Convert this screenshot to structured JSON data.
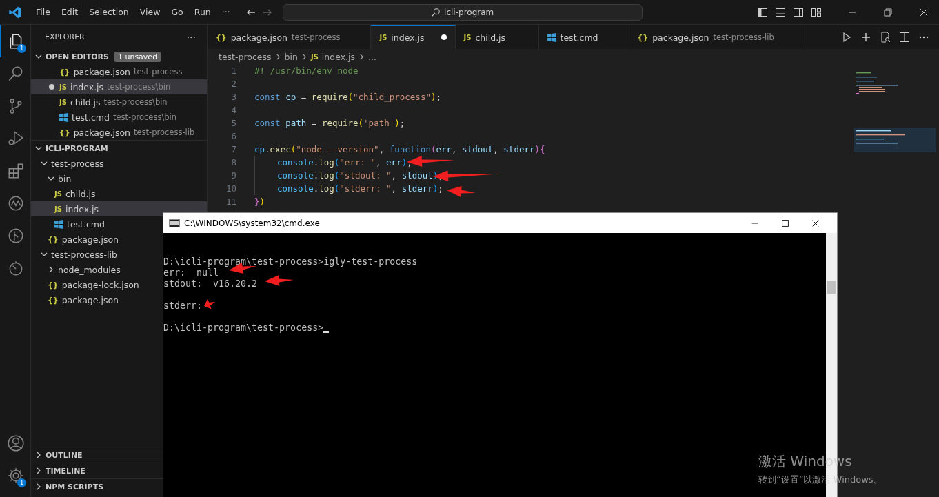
{
  "title_bar": {
    "menus": [
      "File",
      "Edit",
      "Selection",
      "View",
      "Go",
      "Run"
    ],
    "more": "···",
    "search": "icli-program"
  },
  "activity_bar": {
    "top": [
      {
        "kind": "explorer",
        "selected": true,
        "badge": "1"
      },
      {
        "kind": "search",
        "selected": false
      },
      {
        "kind": "source-control",
        "selected": false
      },
      {
        "kind": "run-debug",
        "selected": false
      },
      {
        "kind": "extensions",
        "selected": false
      },
      {
        "kind": "aw",
        "selected": false
      },
      {
        "kind": "git-graph",
        "selected": false
      },
      {
        "kind": "timer",
        "selected": false
      }
    ],
    "bottom": [
      {
        "kind": "account",
        "selected": false
      },
      {
        "kind": "settings",
        "selected": false,
        "badge": "1"
      }
    ]
  },
  "sidebar": {
    "title": "EXPLORER",
    "more": "···",
    "open_editors": {
      "title": "OPEN EDITORS",
      "expanded": true,
      "badge": "1 unsaved",
      "items": [
        {
          "icon": {
            "kind": "json",
            "text": "{}"
          },
          "name": "package.json",
          "path": "test-process",
          "modified": false,
          "selected": false
        },
        {
          "icon": {
            "kind": "js",
            "text": "JS"
          },
          "name": "index.js",
          "path": "test-process\\bin",
          "modified": true,
          "selected": true
        },
        {
          "icon": {
            "kind": "js",
            "text": "JS"
          },
          "name": "child.js",
          "path": "test-process\\bin",
          "modified": false,
          "selected": false
        },
        {
          "icon": {
            "kind": "cmd"
          },
          "name": "test.cmd",
          "path": "test-process\\bin",
          "modified": false,
          "selected": false
        },
        {
          "icon": {
            "kind": "json",
            "text": "{}"
          },
          "name": "package.json",
          "path": "test-process-lib",
          "modified": false,
          "selected": false
        }
      ]
    },
    "folder": {
      "title": "ICLI-PROGRAM",
      "expanded": true,
      "tree": [
        {
          "kind": "folder",
          "name": "test-process",
          "expanded": true,
          "selected": false,
          "children": [
            {
              "kind": "folder",
              "name": "bin",
              "expanded": true,
              "selected": false,
              "children": [
                {
                  "kind": "file",
                  "icon": {
                    "kind": "js",
                    "text": "JS"
                  },
                  "name": "child.js",
                  "selected": false
                },
                {
                  "kind": "file",
                  "icon": {
                    "kind": "js",
                    "text": "JS"
                  },
                  "name": "index.js",
                  "selected": true
                },
                {
                  "kind": "file",
                  "icon": {
                    "kind": "cmd"
                  },
                  "name": "test.cmd",
                  "selected": false
                }
              ]
            },
            {
              "kind": "file",
              "icon": {
                "kind": "json",
                "text": "{}"
              },
              "name": "package.json",
              "selected": false
            }
          ]
        },
        {
          "kind": "folder",
          "name": "test-process-lib",
          "expanded": true,
          "selected": false,
          "children": [
            {
              "kind": "folder",
              "name": "node_modules",
              "expanded": false,
              "selected": false
            },
            {
              "kind": "file",
              "icon": {
                "kind": "json",
                "text": "{}"
              },
              "name": "package-lock.json",
              "selected": false
            },
            {
              "kind": "file",
              "icon": {
                "kind": "json",
                "text": "{}"
              },
              "name": "package.json",
              "selected": false
            }
          ]
        }
      ]
    },
    "sections": [
      {
        "title": "OUTLINE",
        "expanded": false
      },
      {
        "title": "TIMELINE",
        "expanded": false
      },
      {
        "title": "NPM SCRIPTS",
        "expanded": false
      }
    ]
  },
  "tabs": [
    {
      "icon": {
        "kind": "json",
        "text": "{}"
      },
      "name": "package.json",
      "path": "test-process",
      "selected": false,
      "modified": false
    },
    {
      "icon": {
        "kind": "js",
        "text": "JS"
      },
      "name": "index.js",
      "selected": true,
      "modified": true
    },
    {
      "icon": {
        "kind": "js",
        "text": "JS"
      },
      "name": "child.js",
      "selected": false,
      "modified": false
    },
    {
      "icon": {
        "kind": "cmd"
      },
      "name": "test.cmd",
      "selected": false,
      "modified": false
    },
    {
      "icon": {
        "kind": "json",
        "text": "{}"
      },
      "name": "package.json",
      "path": "test-process-lib",
      "selected": false,
      "modified": false
    }
  ],
  "breadcrumb": [
    {
      "name": "test-process"
    },
    {
      "name": "bin"
    },
    {
      "name": "index.js",
      "icon": {
        "kind": "js",
        "text": "JS"
      }
    },
    {
      "name": "..."
    }
  ],
  "code": [
    {
      "n": "1",
      "text": "#! /usr/bin/env node"
    },
    {
      "n": "2"
    },
    {
      "n": "3",
      "text": "const cp = require(\"child_process\");"
    },
    {
      "n": "4"
    },
    {
      "n": "5",
      "text": "const path = require('path');"
    },
    {
      "n": "6"
    },
    {
      "n": "7",
      "text": "cp.exec(\"node --version\", function(err, stdout, stderr){",
      "children": [
        {
          "n": "8",
          "text": "console.log(\"err: \", err);"
        },
        {
          "n": "9",
          "text": "console.log(\"stdout: \", stdout);"
        },
        {
          "n": "10",
          "text": "console.log(\"stderr: \", stderr);"
        }
      ]
    },
    {
      "n": "11",
      "text": "})"
    }
  ],
  "cmd_window": {
    "title": "C:\\WINDOWS\\system32\\cmd.exe",
    "lines": [
      {
        "text": "D:\\icli-program\\test-process>igly-test-process",
        "blank_before": true
      },
      {
        "text": "err:  null",
        "blank_before": false
      },
      {
        "text": "stdout:  v16.20.2",
        "blank_before": false
      },
      {
        "text": "stderr:",
        "blank_before": true
      },
      {
        "text": "D:\\icli-program\\test-process>",
        "blank_before": true,
        "cursor": true
      }
    ]
  },
  "activation": {
    "title": "激活 Windows",
    "hint": "转到“设置”以激活 Windows。"
  }
}
